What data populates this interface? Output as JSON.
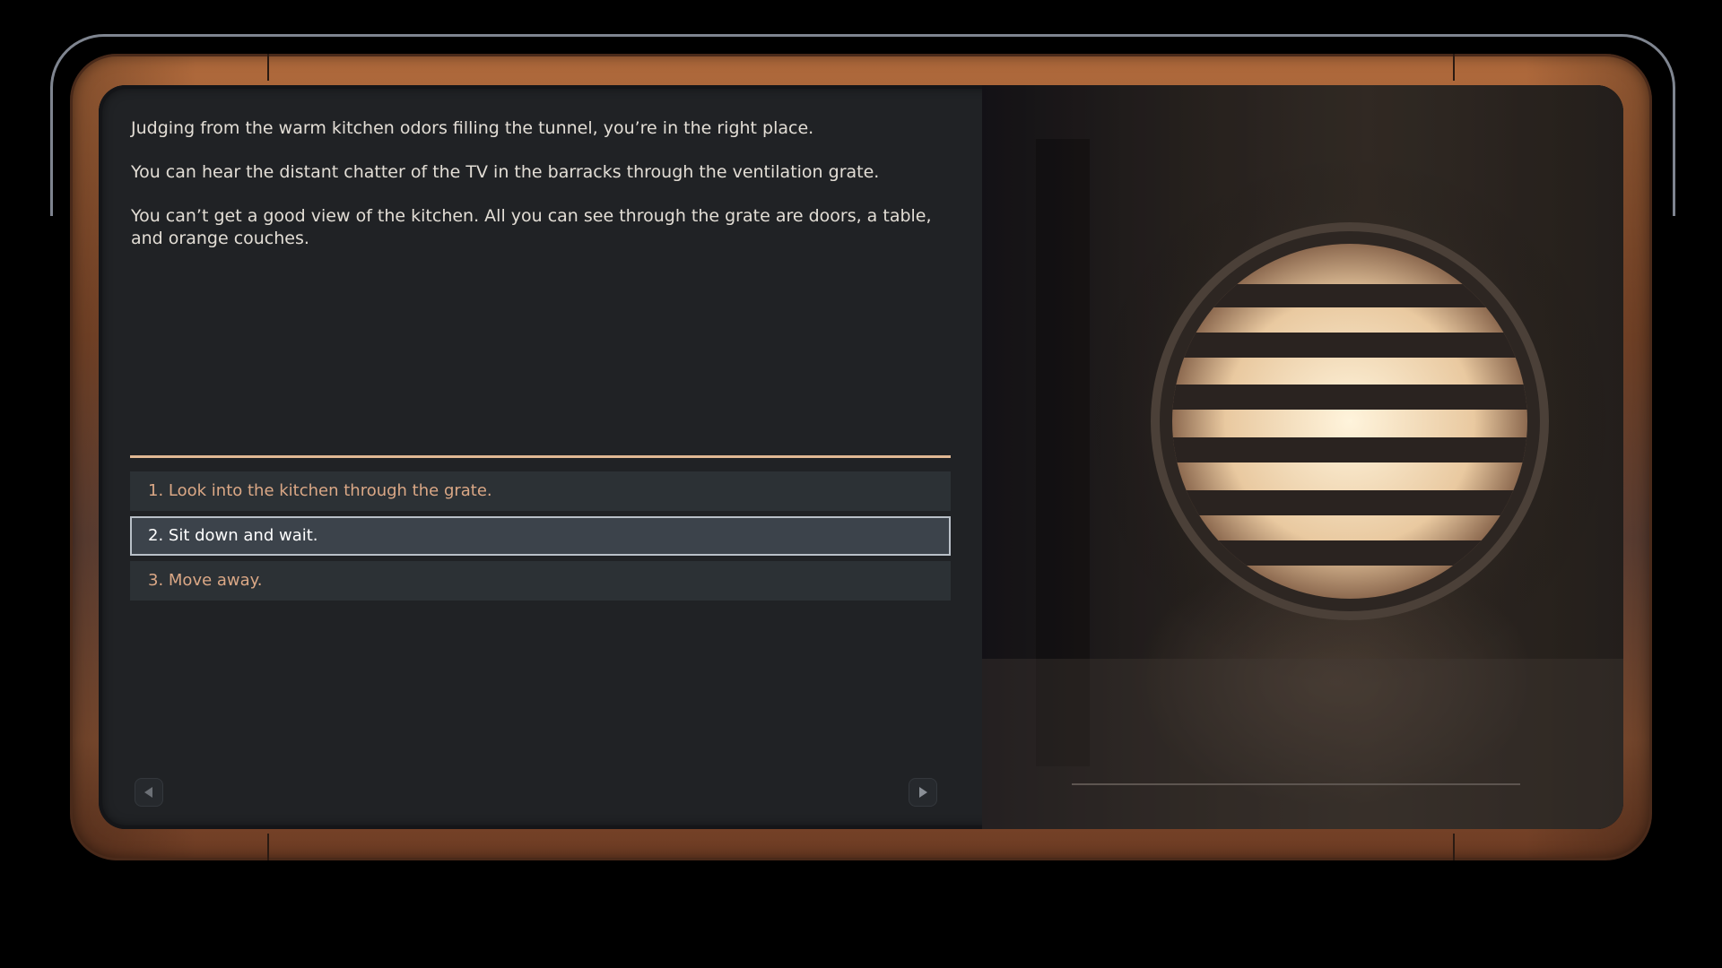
{
  "narrative": {
    "paragraphs": [
      "Judging from the warm kitchen odors filling the tunnel, you’re in the right place.",
      "You can hear the distant chatter of the TV in the barracks through the ventilation grate.",
      "You can’t get a good view of the kitchen. All you can see through the grate are doors, a table, and orange couches."
    ]
  },
  "choices": [
    {
      "label": "1. Look into the kitchen through the grate.",
      "selected": false
    },
    {
      "label": "2. Sit down and wait.",
      "selected": true
    },
    {
      "label": "3. Move away.",
      "selected": false
    }
  ],
  "navigation": {
    "prev_icon": "triangle-left-icon",
    "next_icon": "triangle-right-icon"
  },
  "illustration": {
    "subject": "circular ventilation grate lit from behind in a dark tunnel"
  },
  "colors": {
    "text": "#e2ddd5",
    "choice_text": "#dba886",
    "selected_text": "#ffffff",
    "divider": "#e0b894",
    "frame_copper": "#9a5a34",
    "panel": "#202225"
  }
}
